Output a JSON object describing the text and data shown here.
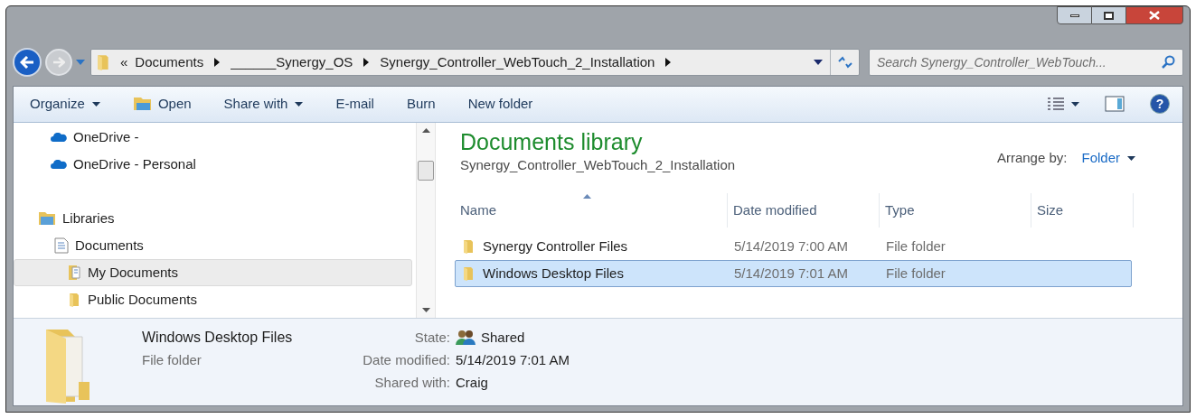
{
  "address_bar": {
    "overflow": "«",
    "crumbs": [
      "Documents",
      "______Synergy_OS",
      "Synergy_Controller_WebTouch_2_Installation"
    ]
  },
  "search": {
    "placeholder": "Search Synergy_Controller_WebTouch..."
  },
  "toolbar": [
    {
      "label": "Organize",
      "kind": "menu"
    },
    {
      "label": "Open",
      "kind": "icon"
    },
    {
      "label": "Share with",
      "kind": "menu"
    },
    {
      "label": "E-mail",
      "kind": "plain"
    },
    {
      "label": "Burn",
      "kind": "plain"
    },
    {
      "label": "New folder",
      "kind": "plain"
    }
  ],
  "help": {
    "label": "?"
  },
  "nav_tree": [
    {
      "label": "OneDrive -",
      "kind": "cloud",
      "selected": false
    },
    {
      "label": "OneDrive - Personal",
      "kind": "cloud",
      "selected": false
    },
    {
      "label": "Libraries",
      "kind": "library",
      "selected": false,
      "children": [
        {
          "label": "Documents",
          "kind": "document",
          "selected": false,
          "children": [
            {
              "label": "My Documents",
              "kind": "folder-doc",
              "selected": true
            },
            {
              "label": "Public Documents",
              "kind": "folder",
              "selected": false
            }
          ]
        }
      ]
    }
  ],
  "library": {
    "title": "Documents library",
    "subtitle": "Synergy_Controller_WebTouch_2_Installation",
    "arrange_label": "Arrange by:",
    "arrange_value": "Folder"
  },
  "table": {
    "columns": [
      "Name",
      "Date modified",
      "Type",
      "Size"
    ],
    "rows": [
      {
        "name": "Synergy Controller Files",
        "date": "5/14/2019 7:00 AM",
        "type": "File folder",
        "selected": false
      },
      {
        "name": "Windows Desktop Files",
        "date": "5/14/2019 7:01 AM",
        "type": "File folder",
        "selected": true
      }
    ]
  },
  "details": {
    "name": "Windows Desktop Files",
    "type": "File folder",
    "properties": [
      {
        "label": "State:",
        "value": "Shared",
        "kind": "shared"
      },
      {
        "label": "Date modified:",
        "value": "5/14/2019 7:01 AM",
        "kind": "plain"
      },
      {
        "label": "Shared with:",
        "value": "Craig",
        "kind": "plain"
      }
    ]
  }
}
